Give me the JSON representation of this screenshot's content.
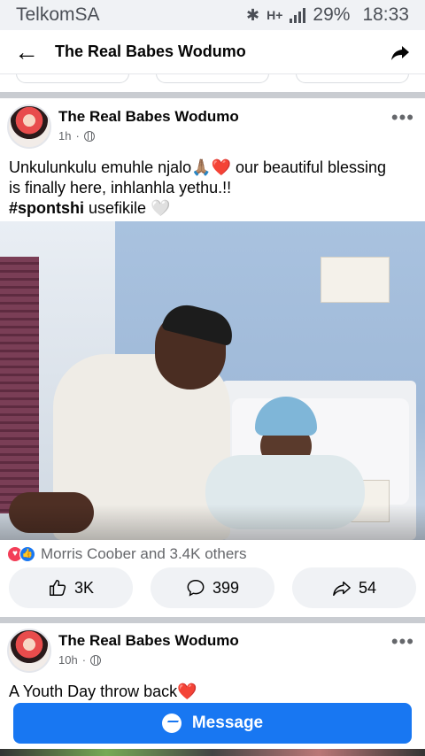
{
  "status_bar": {
    "carrier": "TelkomSA",
    "network": "H+",
    "battery": "29%",
    "time": "18:33"
  },
  "header": {
    "title": "The Real Babes Wodumo",
    "back_icon": "arrow-left-icon",
    "share_icon": "share-arrow-icon"
  },
  "post": {
    "author": "The Real Babes Wodumo",
    "time": "1h",
    "dot": "·",
    "more": "•••",
    "text_line1": "Unkulunkulu emuhle njalo🙏🏽❤️ our beautiful blessing",
    "text_line2": "is finally here, inhlanhla yethu.!!",
    "hashtag": "#spontshi",
    "text_line3_rest": " usefikile 🤍",
    "reactions_text": "Morris Coober and 3.4K others",
    "like_count": "3K",
    "comment_count": "399",
    "share_count": "54"
  },
  "next_post": {
    "author": "The Real Babes Wodumo",
    "time": "10h",
    "dot": "·",
    "more": "•••",
    "text": "A Youth Day throw back❤️"
  },
  "message_button": {
    "label": "Message"
  },
  "colors": {
    "accent": "#1877f2",
    "love": "#f33e58"
  }
}
